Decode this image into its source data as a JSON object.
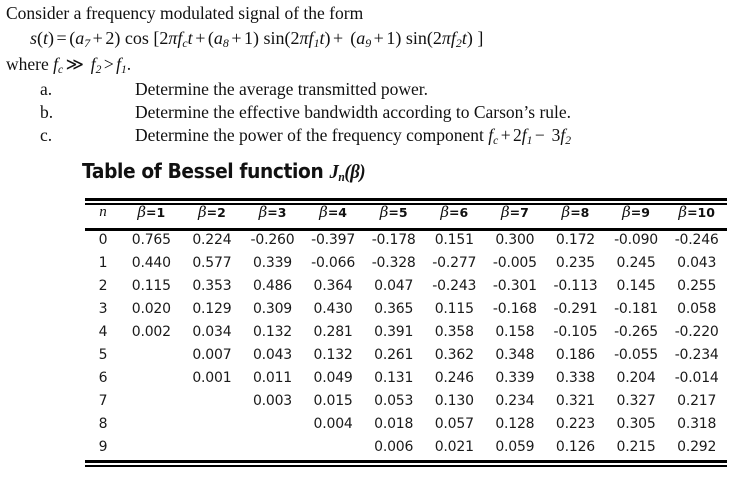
{
  "problem": {
    "intro": "Consider a frequency modulated signal of the form",
    "equation_plain": "s(t) = (a7 + 2) cos [2π fc t + (a8 + 1) sin(2π f1 t) + (a9 + 1) sin(2π f2 t) ]",
    "where_plain": "where fc ≫ f2 > f1.",
    "questions": [
      {
        "label": "a.",
        "text": "Determine the average transmitted power."
      },
      {
        "label": "b.",
        "text": "Determine the effective bandwidth according to Carson’s rule."
      },
      {
        "label": "c.",
        "text": "Determine the power of the frequency component fc + 2f1 − 3f2"
      }
    ]
  },
  "bessel_table": {
    "title_prefix": "Table of Bessel function",
    "title_symbol": "Jn(β)",
    "row_header": "n",
    "columns": [
      "β=1",
      "β=2",
      "β=3",
      "β=4",
      "β=5",
      "β=6",
      "β=7",
      "β=8",
      "β=9",
      "β=10"
    ],
    "beta_values": [
      1,
      2,
      3,
      4,
      5,
      6,
      7,
      8,
      9,
      10
    ],
    "rows": [
      {
        "n": "0",
        "values": [
          "0.765",
          "0.224",
          "-0.260",
          "-0.397",
          "-0.178",
          "0.151",
          "0.300",
          "0.172",
          "-0.090",
          "-0.246"
        ]
      },
      {
        "n": "1",
        "values": [
          "0.440",
          "0.577",
          "0.339",
          "-0.066",
          "-0.328",
          "-0.277",
          "-0.005",
          "0.235",
          "0.245",
          "0.043"
        ]
      },
      {
        "n": "2",
        "values": [
          "0.115",
          "0.353",
          "0.486",
          "0.364",
          "0.047",
          "-0.243",
          "-0.301",
          "-0.113",
          "0.145",
          "0.255"
        ]
      },
      {
        "n": "3",
        "values": [
          "0.020",
          "0.129",
          "0.309",
          "0.430",
          "0.365",
          "0.115",
          "-0.168",
          "-0.291",
          "-0.181",
          "0.058"
        ]
      },
      {
        "n": "4",
        "values": [
          "0.002",
          "0.034",
          "0.132",
          "0.281",
          "0.391",
          "0.358",
          "0.158",
          "-0.105",
          "-0.265",
          "-0.220"
        ]
      },
      {
        "n": "5",
        "values": [
          "",
          "0.007",
          "0.043",
          "0.132",
          "0.261",
          "0.362",
          "0.348",
          "0.186",
          "-0.055",
          "-0.234"
        ]
      },
      {
        "n": "6",
        "values": [
          "",
          "0.001",
          "0.011",
          "0.049",
          "0.131",
          "0.246",
          "0.339",
          "0.338",
          "0.204",
          "-0.014"
        ]
      },
      {
        "n": "7",
        "values": [
          "",
          "",
          "0.003",
          "0.015",
          "0.053",
          "0.130",
          "0.234",
          "0.321",
          "0.327",
          "0.217"
        ]
      },
      {
        "n": "8",
        "values": [
          "",
          "",
          "",
          "0.004",
          "0.018",
          "0.057",
          "0.128",
          "0.223",
          "0.305",
          "0.318"
        ]
      },
      {
        "n": "9",
        "values": [
          "",
          "",
          "",
          "",
          "0.006",
          "0.021",
          "0.059",
          "0.126",
          "0.215",
          "0.292"
        ]
      }
    ]
  }
}
